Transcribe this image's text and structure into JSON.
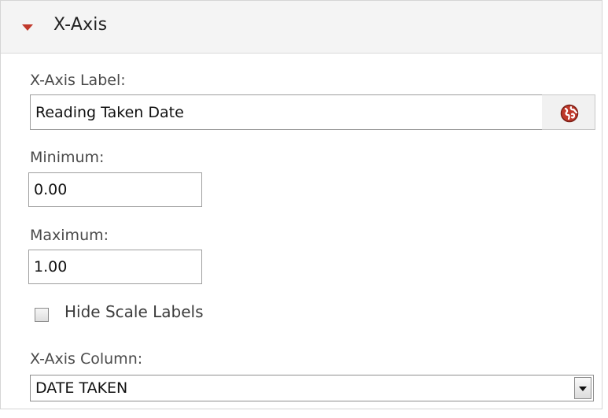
{
  "section": {
    "title": "X-Axis",
    "caret_icon": "caret-down-icon",
    "accent_color": "#c0392b"
  },
  "x_axis_label": {
    "label": "X-Axis Label:",
    "value": "Reading Taken Date",
    "globe_icon": "globe-icon"
  },
  "minimum": {
    "label": "Minimum:",
    "value": "0.00"
  },
  "maximum": {
    "label": "Maximum:",
    "value": "1.00"
  },
  "hide_scale_labels": {
    "label": "Hide Scale Labels",
    "checked": false
  },
  "x_axis_column": {
    "label": "X-Axis Column:",
    "selected": "DATE TAKEN"
  }
}
